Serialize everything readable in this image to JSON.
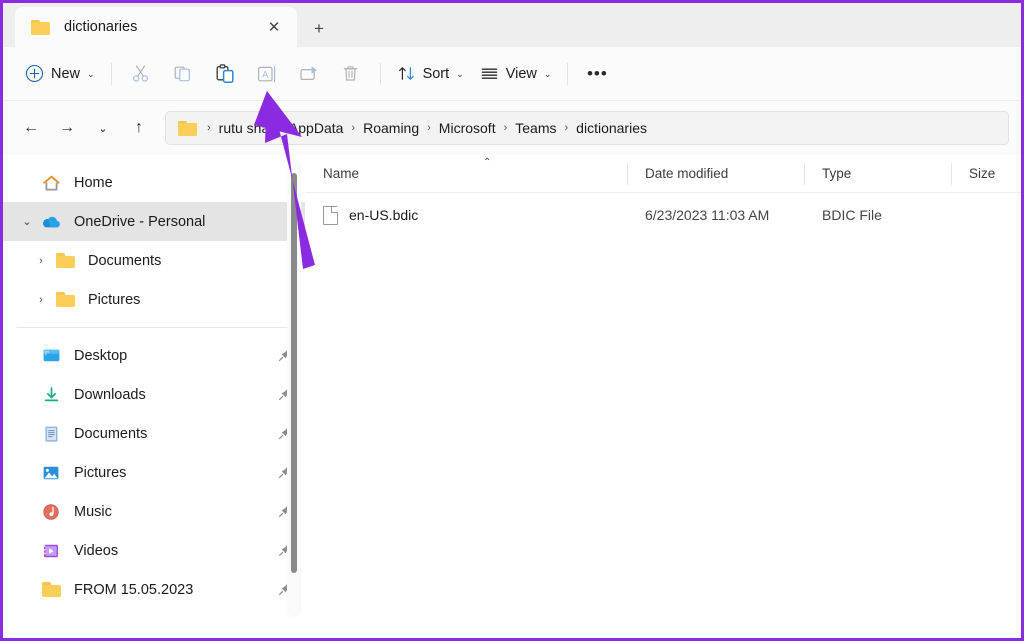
{
  "window": {
    "annotation_border_color": "#8A2BE2"
  },
  "tabs": {
    "items": [
      {
        "label": "dictionaries",
        "icon": "folder-icon",
        "active": true
      }
    ],
    "close_glyph": "✕",
    "newtab_glyph": "+",
    "newtab_name": "new-tab"
  },
  "toolbar": {
    "new_label": "New",
    "new_icon": "plus-circle-icon",
    "chevron_glyph": "⌄",
    "buttons": [
      {
        "name": "cut-button",
        "icon": "scissors-icon",
        "enabled": false
      },
      {
        "name": "copy-button",
        "icon": "copy-icon",
        "enabled": false
      },
      {
        "name": "paste-button",
        "icon": "paste-icon",
        "enabled": true
      },
      {
        "name": "rename-button",
        "icon": "rename-icon",
        "enabled": false
      },
      {
        "name": "share-button",
        "icon": "share-icon",
        "enabled": false
      },
      {
        "name": "delete-button",
        "icon": "trash-icon",
        "enabled": false
      }
    ],
    "sort_label": "Sort",
    "sort_icon": "sort-arrows-icon",
    "view_label": "View",
    "view_icon": "view-lines-icon",
    "more_label": "•••",
    "more_name": "see-more-button"
  },
  "addressbar": {
    "back_glyph": "←",
    "forward_glyph": "→",
    "recent_glyph": "⌄",
    "up_glyph": "↑",
    "separator": "›",
    "breadcrumbs": [
      "rutu sha",
      "AppData",
      "Roaming",
      "Microsoft",
      "Teams",
      "dictionaries"
    ]
  },
  "sidebar": {
    "expand_glyph": "›",
    "collapse_glyph": "⌄",
    "pin_glyph": "📌",
    "groups": [
      {
        "items": [
          {
            "label": "Home",
            "icon": "home-icon",
            "twisty": "",
            "indent": 0,
            "selected": false,
            "pinned": false
          },
          {
            "label": "OneDrive - Personal",
            "icon": "onedrive-cloud-icon",
            "twisty": "collapse",
            "indent": 0,
            "selected": true,
            "pinned": false
          },
          {
            "label": "Documents",
            "icon": "folder-icon",
            "twisty": "expand",
            "indent": 1,
            "selected": false,
            "pinned": false
          },
          {
            "label": "Pictures",
            "icon": "folder-icon",
            "twisty": "expand",
            "indent": 1,
            "selected": false,
            "pinned": false
          }
        ]
      },
      {
        "items": [
          {
            "label": "Desktop",
            "icon": "desktop-icon",
            "twisty": "",
            "indent": 0,
            "selected": false,
            "pinned": true
          },
          {
            "label": "Downloads",
            "icon": "downloads-icon",
            "twisty": "",
            "indent": 0,
            "selected": false,
            "pinned": true
          },
          {
            "label": "Documents",
            "icon": "documents-icon",
            "twisty": "",
            "indent": 0,
            "selected": false,
            "pinned": true
          },
          {
            "label": "Pictures",
            "icon": "pictures-icon",
            "twisty": "",
            "indent": 0,
            "selected": false,
            "pinned": true
          },
          {
            "label": "Music",
            "icon": "music-icon",
            "twisty": "",
            "indent": 0,
            "selected": false,
            "pinned": true
          },
          {
            "label": "Videos",
            "icon": "videos-icon",
            "twisty": "",
            "indent": 0,
            "selected": false,
            "pinned": true
          },
          {
            "label": "FROM 15.05.2023",
            "icon": "folder-icon",
            "twisty": "",
            "indent": 0,
            "selected": false,
            "pinned": true
          }
        ]
      }
    ]
  },
  "filelist": {
    "columns": [
      {
        "label": "Name",
        "sorted": "asc",
        "sort_glyph": "⌃"
      },
      {
        "label": "Date modified",
        "sorted": ""
      },
      {
        "label": "Type",
        "sorted": ""
      },
      {
        "label": "Size",
        "sorted": ""
      }
    ],
    "rows": [
      {
        "name": "en-US.bdic",
        "date_modified": "6/23/2023 11:03 AM",
        "type": "BDIC File",
        "size": "",
        "icon": "generic-file-icon"
      }
    ]
  },
  "annotation": {
    "arrow_color": "#8A2BE2",
    "arrow_points_at": "paste-button"
  }
}
